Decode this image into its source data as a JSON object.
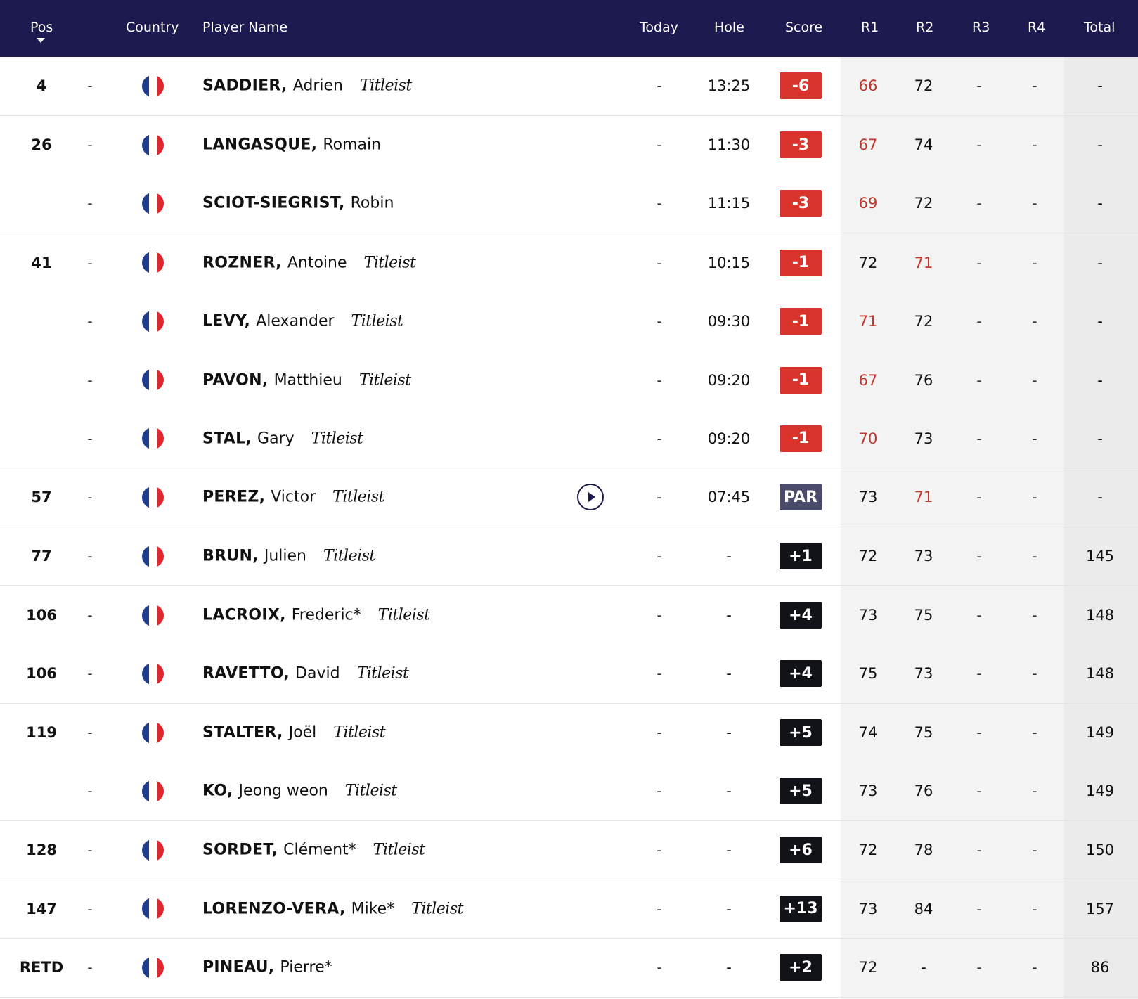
{
  "header": {
    "pos": "Pos",
    "country": "Country",
    "player": "Player Name",
    "today": "Today",
    "hole": "Hole",
    "score": "Score",
    "r1": "R1",
    "r2": "R2",
    "r3": "R3",
    "r4": "R4",
    "total": "Total"
  },
  "colors": {
    "header_bg": "#1c1a4e",
    "under_par": "#d9342b",
    "even_par": "#4a4a6a",
    "over_par": "#111318",
    "highlight_round": "#c4342d"
  },
  "flag_icon": "france-flag-icon",
  "rows": [
    {
      "pos": "4",
      "mov": "-",
      "last": "SADDIER,",
      "first": "Adrien",
      "brand": "Titleist",
      "video": false,
      "today": "-",
      "hole": "13:25",
      "score": "-6",
      "score_type": "under",
      "r1": "66",
      "r1_highlight": true,
      "r2": "72",
      "r2_highlight": false,
      "r3": "-",
      "r4": "-",
      "total": "-",
      "sep": true
    },
    {
      "pos": "26",
      "mov": "-",
      "last": "LANGASQUE,",
      "first": "Romain",
      "brand": "",
      "video": false,
      "today": "-",
      "hole": "11:30",
      "score": "-3",
      "score_type": "under",
      "r1": "67",
      "r1_highlight": true,
      "r2": "74",
      "r2_highlight": false,
      "r3": "-",
      "r4": "-",
      "total": "-",
      "sep": false
    },
    {
      "pos": "",
      "mov": "-",
      "last": "SCIOT-SIEGRIST,",
      "first": "Robin",
      "brand": "",
      "video": false,
      "today": "-",
      "hole": "11:15",
      "score": "-3",
      "score_type": "under",
      "r1": "69",
      "r1_highlight": true,
      "r2": "72",
      "r2_highlight": false,
      "r3": "-",
      "r4": "-",
      "total": "-",
      "sep": true
    },
    {
      "pos": "41",
      "mov": "-",
      "last": "ROZNER,",
      "first": "Antoine",
      "brand": "Titleist",
      "video": false,
      "today": "-",
      "hole": "10:15",
      "score": "-1",
      "score_type": "under",
      "r1": "72",
      "r1_highlight": false,
      "r2": "71",
      "r2_highlight": true,
      "r3": "-",
      "r4": "-",
      "total": "-",
      "sep": false
    },
    {
      "pos": "",
      "mov": "-",
      "last": "LEVY,",
      "first": "Alexander",
      "brand": "Titleist",
      "video": false,
      "today": "-",
      "hole": "09:30",
      "score": "-1",
      "score_type": "under",
      "r1": "71",
      "r1_highlight": true,
      "r2": "72",
      "r2_highlight": false,
      "r3": "-",
      "r4": "-",
      "total": "-",
      "sep": false
    },
    {
      "pos": "",
      "mov": "-",
      "last": "PAVON,",
      "first": "Matthieu",
      "brand": "Titleist",
      "video": false,
      "today": "-",
      "hole": "09:20",
      "score": "-1",
      "score_type": "under",
      "r1": "67",
      "r1_highlight": true,
      "r2": "76",
      "r2_highlight": false,
      "r3": "-",
      "r4": "-",
      "total": "-",
      "sep": false
    },
    {
      "pos": "",
      "mov": "-",
      "last": "STAL,",
      "first": "Gary",
      "brand": "Titleist",
      "video": false,
      "today": "-",
      "hole": "09:20",
      "score": "-1",
      "score_type": "under",
      "r1": "70",
      "r1_highlight": true,
      "r2": "73",
      "r2_highlight": false,
      "r3": "-",
      "r4": "-",
      "total": "-",
      "sep": true
    },
    {
      "pos": "57",
      "mov": "-",
      "last": "PEREZ,",
      "first": "Victor",
      "brand": "Titleist",
      "video": true,
      "today": "-",
      "hole": "07:45",
      "score": "PAR",
      "score_type": "even",
      "r1": "73",
      "r1_highlight": false,
      "r2": "71",
      "r2_highlight": true,
      "r3": "-",
      "r4": "-",
      "total": "-",
      "sep": true
    },
    {
      "pos": "77",
      "mov": "-",
      "last": "BRUN,",
      "first": "Julien",
      "brand": "Titleist",
      "video": false,
      "today": "-",
      "hole": "-",
      "score": "+1",
      "score_type": "over",
      "r1": "72",
      "r1_highlight": false,
      "r2": "73",
      "r2_highlight": false,
      "r3": "-",
      "r4": "-",
      "total": "145",
      "sep": true
    },
    {
      "pos": "106",
      "mov": "-",
      "last": "LACROIX,",
      "first": "Frederic*",
      "brand": "Titleist",
      "video": false,
      "today": "-",
      "hole": "-",
      "score": "+4",
      "score_type": "over",
      "r1": "73",
      "r1_highlight": false,
      "r2": "75",
      "r2_highlight": false,
      "r3": "-",
      "r4": "-",
      "total": "148",
      "sep": false
    },
    {
      "pos": "106",
      "mov": "-",
      "last": "RAVETTO,",
      "first": "David",
      "brand": "Titleist",
      "video": false,
      "today": "-",
      "hole": "-",
      "score": "+4",
      "score_type": "over",
      "r1": "75",
      "r1_highlight": false,
      "r2": "73",
      "r2_highlight": false,
      "r3": "-",
      "r4": "-",
      "total": "148",
      "sep": true
    },
    {
      "pos": "119",
      "mov": "-",
      "last": "STALTER,",
      "first": "Joël",
      "brand": "Titleist",
      "video": false,
      "today": "-",
      "hole": "-",
      "score": "+5",
      "score_type": "over",
      "r1": "74",
      "r1_highlight": false,
      "r2": "75",
      "r2_highlight": false,
      "r3": "-",
      "r4": "-",
      "total": "149",
      "sep": false
    },
    {
      "pos": "",
      "mov": "-",
      "last": "KO,",
      "first": "Jeong weon",
      "brand": "Titleist",
      "video": false,
      "today": "-",
      "hole": "-",
      "score": "+5",
      "score_type": "over",
      "r1": "73",
      "r1_highlight": false,
      "r2": "76",
      "r2_highlight": false,
      "r3": "-",
      "r4": "-",
      "total": "149",
      "sep": true
    },
    {
      "pos": "128",
      "mov": "-",
      "last": "SORDET,",
      "first": "Clément*",
      "brand": "Titleist",
      "video": false,
      "today": "-",
      "hole": "-",
      "score": "+6",
      "score_type": "over",
      "r1": "72",
      "r1_highlight": false,
      "r2": "78",
      "r2_highlight": false,
      "r3": "-",
      "r4": "-",
      "total": "150",
      "sep": true
    },
    {
      "pos": "147",
      "mov": "-",
      "last": "LORENZO-VERA,",
      "first": "Mike*",
      "brand": "Titleist",
      "video": false,
      "today": "-",
      "hole": "-",
      "score": "+13",
      "score_type": "over",
      "r1": "73",
      "r1_highlight": false,
      "r2": "84",
      "r2_highlight": false,
      "r3": "-",
      "r4": "-",
      "total": "157",
      "sep": true
    },
    {
      "pos": "RETD",
      "mov": "-",
      "last": "PINEAU,",
      "first": "Pierre*",
      "brand": "",
      "video": false,
      "today": "-",
      "hole": "-",
      "score": "+2",
      "score_type": "over",
      "r1": "72",
      "r1_highlight": false,
      "r2": "-",
      "r2_highlight": false,
      "r3": "-",
      "r4": "-",
      "total": "86",
      "sep": true
    }
  ]
}
